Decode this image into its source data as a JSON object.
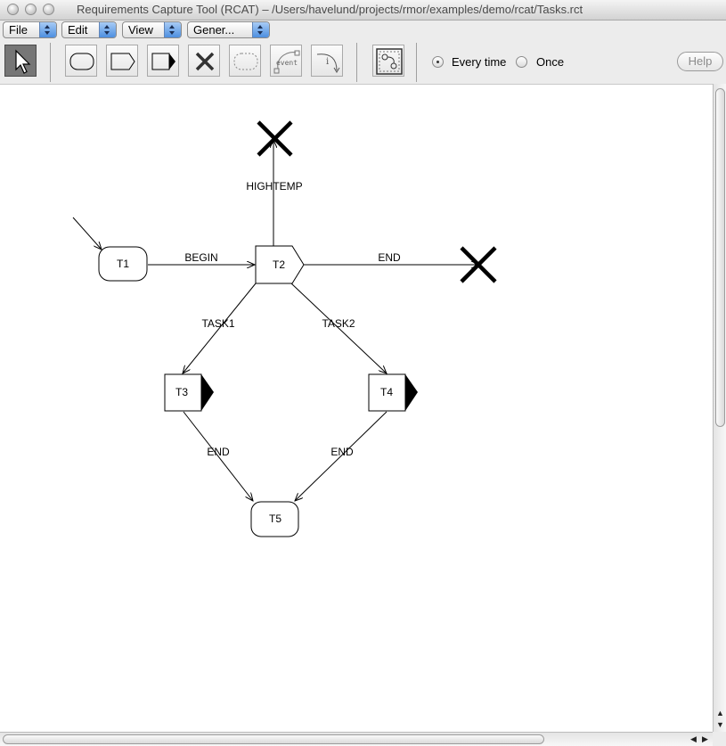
{
  "window": {
    "title": "Requirements Capture Tool (RCAT) – /Users/havelund/projects/rmor/examples/demo/rcat/Tasks.rct"
  },
  "menus": [
    {
      "label": "File"
    },
    {
      "label": "Edit"
    },
    {
      "label": "View"
    },
    {
      "label": "Gener..."
    }
  ],
  "toolbar": {
    "tools": [
      {
        "icon": "pointer-icon"
      },
      {
        "icon": "rounded-state-icon"
      },
      {
        "icon": "pentagon-state-icon"
      },
      {
        "icon": "flag-state-icon"
      },
      {
        "icon": "error-cross-icon"
      },
      {
        "icon": "dashed-state-icon"
      },
      {
        "icon": "event-icon",
        "text": "event"
      },
      {
        "icon": "info-transition-icon",
        "text": "i"
      },
      {
        "icon": "layout-icon"
      }
    ],
    "radio_every_time": "Every time",
    "radio_once": "Once",
    "selected_radio": "Every time",
    "help_label": "Help"
  },
  "diagram": {
    "nodes": [
      {
        "id": "T1",
        "label": "T1",
        "shape": "rounded"
      },
      {
        "id": "T2",
        "label": "T2",
        "shape": "pentagon"
      },
      {
        "id": "T3",
        "label": "T3",
        "shape": "flag"
      },
      {
        "id": "T4",
        "label": "T4",
        "shape": "flag"
      },
      {
        "id": "T5",
        "label": "T5",
        "shape": "rounded"
      },
      {
        "id": "X1",
        "label": "",
        "shape": "cross"
      },
      {
        "id": "X2",
        "label": "",
        "shape": "cross"
      }
    ],
    "edges": [
      {
        "from": "start",
        "to": "T1",
        "label": ""
      },
      {
        "from": "T1",
        "to": "T2",
        "label": "BEGIN"
      },
      {
        "from": "T2",
        "to": "X1",
        "label": "HIGHTEMP"
      },
      {
        "from": "T2",
        "to": "X2",
        "label": "END"
      },
      {
        "from": "T2",
        "to": "T3",
        "label": "TASK1"
      },
      {
        "from": "T2",
        "to": "T4",
        "label": "TASK2"
      },
      {
        "from": "T3",
        "to": "T5",
        "label": "END"
      },
      {
        "from": "T4",
        "to": "T5",
        "label": "END"
      }
    ]
  },
  "colors": {
    "canvas": "#ffffff",
    "chrome": "#ececec",
    "dropdown_accent": "#4d8fe0",
    "selected_tool": "#767676"
  }
}
